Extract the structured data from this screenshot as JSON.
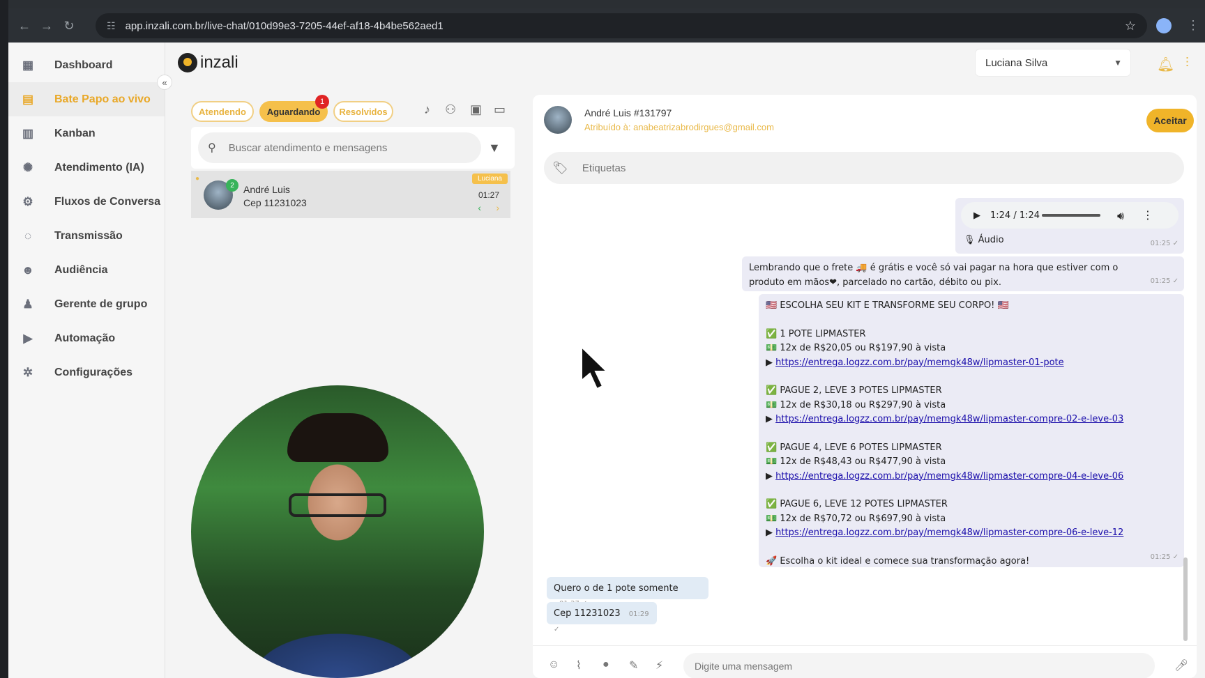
{
  "browser": {
    "url": "app.inzali.com.br/live-chat/010d99e3-7205-44ef-af18-4b4be562aed1"
  },
  "sidebar": {
    "items": [
      {
        "label": "Dashboard",
        "icon": "dashboard-icon"
      },
      {
        "label": "Bate Papo ao vivo",
        "icon": "chat-icon",
        "active": true
      },
      {
        "label": "Kanban",
        "icon": "kanban-icon"
      },
      {
        "label": "Atendimento (IA)",
        "icon": "ai-icon"
      },
      {
        "label": "Fluxos de Conversa",
        "icon": "flow-icon"
      },
      {
        "label": "Transmissão",
        "icon": "broadcast-icon"
      },
      {
        "label": "Audiência",
        "icon": "audience-icon"
      },
      {
        "label": "Gerente de grupo",
        "icon": "group-manager-icon"
      },
      {
        "label": "Automação",
        "icon": "play-icon"
      },
      {
        "label": "Configurações",
        "icon": "gear-icon"
      }
    ]
  },
  "header": {
    "logo_text": "inzali",
    "user_name": "Luciana Silva"
  },
  "tabs": {
    "atendendo": "Atendendo",
    "aguardando": "Aguardando",
    "aguardando_badge": "1",
    "resolvidos": "Resolvidos"
  },
  "search": {
    "placeholder": "Buscar atendimento e mensagens"
  },
  "chat_list": [
    {
      "name": "André Luis",
      "last_message": "Cep 11231023",
      "time": "01:27",
      "unread": "2",
      "agent_tag": "Luciana"
    }
  ],
  "conversation": {
    "contact_name": "André Luis #131797",
    "assigned": "Atribuído à: anabeatrizabrodirgues@gmail.com",
    "accept_label": "Aceitar",
    "tags_placeholder": "Etiquetas",
    "composer_placeholder": "Digite uma mensagem",
    "messages": {
      "audio": {
        "player_time": "1:24 / 1:24",
        "progress": 1.0,
        "label": "🎙 Áudio",
        "time": "01:25"
      },
      "frete": {
        "line1": "Lembrando que o frete 🚚 é grátis e você só vai pagar na hora que estiver com o",
        "line2": "produto em mãos❤, parcelado no cartão, débito ou pix.",
        "time": "01:25"
      },
      "promo": {
        "headline": "🇺🇸 ESCOLHA SEU KIT E TRANSFORME SEU CORPO! 🇺🇸",
        "offers": [
          {
            "title": "✅ 1 POTE LIPMASTER",
            "price": "💵 12x de R$20,05 ou R$197,90 à vista",
            "link": "https://entrega.logzz.com.br/pay/memgk48w/lipmaster-01-pote"
          },
          {
            "title": "✅ PAGUE 2, LEVE 3 POTES LIPMASTER",
            "price": "💵 12x de R$30,18 ou R$297,90 à vista",
            "link": "https://entrega.logzz.com.br/pay/memgk48w/lipmaster-compre-02-e-leve-03"
          },
          {
            "title": "✅ PAGUE 4, LEVE 6 POTES LIPMASTER",
            "price": "💵 12x de R$48,43 ou R$477,90 à vista",
            "link": "https://entrega.logzz.com.br/pay/memgk48w/lipmaster-compre-04-e-leve-06"
          },
          {
            "title": "✅ PAGUE 6, LEVE 12 POTES LIPMASTER",
            "price": "💵 12x de R$70,72 ou R$697,90 à vista",
            "link": "https://entrega.logzz.com.br/pay/memgk48w/lipmaster-compre-06-e-leve-12"
          }
        ],
        "closing": "🚀 Escolha o kit ideal e comece sua transformação agora!",
        "time": "01:25"
      },
      "pote": {
        "text": "Quero o de 1 pote somente",
        "time": "01:27"
      },
      "cep": {
        "text": "Cep 11231023",
        "time": "01:29"
      }
    }
  },
  "colors": {
    "accent": "#f0b429",
    "sidebar_active": "#e9a828",
    "incoming_bubble": "#e1ebf5",
    "outgoing_bubble": "#ebebf5"
  }
}
